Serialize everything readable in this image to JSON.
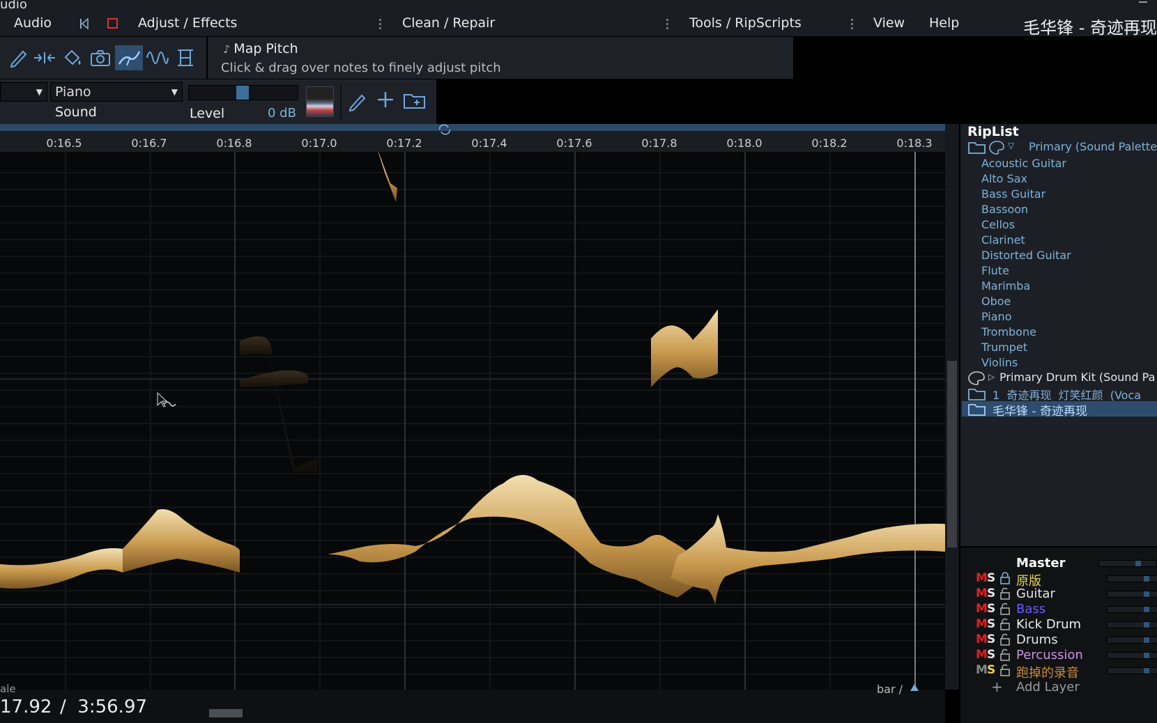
{
  "menubar": {
    "app_title_fragment": "udio",
    "items": [
      "Audio",
      "Adjust / Effects",
      "Clean / Repair",
      "Tools / RipScripts",
      "View",
      "Help"
    ],
    "song_title": "毛华锋 - 奇迹再现"
  },
  "tool_info": {
    "name": "Map Pitch",
    "hint": "Click & drag over notes to finely adjust pitch"
  },
  "sound_bar": {
    "instrument": "Piano",
    "sound_label": "Sound",
    "level_label": "Level",
    "level_value": "0 dB"
  },
  "timeline": {
    "ticks": [
      "0:16.5",
      "0:16.7",
      "0:16.8",
      "0:17.0",
      "0:17.2",
      "0:17.4",
      "0:17.6",
      "0:17.8",
      "0:18.0",
      "0:18.2",
      "0:18.3"
    ]
  },
  "footer": {
    "corner_label": "ale",
    "current_time": "17.92",
    "total_time": "/  3:56.97",
    "bar_label": "bar /"
  },
  "riplist": {
    "title": "RipList",
    "primary_label": "Primary (Sound Palette",
    "instruments": [
      "Acoustic Guitar",
      "Alto Sax",
      "Bass Guitar",
      "Bassoon",
      "Cellos",
      "Clarinet",
      "Distorted Guitar",
      "Flute",
      "Marimba",
      "Oboe",
      "Piano",
      "Trombone",
      "Trumpet",
      "Violins"
    ],
    "drum_kit_label": "Primary Drum Kit (Sound Pa",
    "vocal_label": "1  奇迹再现  灯笑红颜  (Voca",
    "selected_label": "毛华锋 - 奇迹再现"
  },
  "mixer": {
    "master_label": "Master",
    "layers": [
      {
        "name": "原版",
        "color": "#e8d44c"
      },
      {
        "name": "Guitar",
        "color": "#e6e6e6"
      },
      {
        "name": "Bass",
        "color": "#6a5cff"
      },
      {
        "name": "Kick Drum",
        "color": "#f0f0f0"
      },
      {
        "name": "Drums",
        "color": "#e6e6e6"
      },
      {
        "name": "Percussion",
        "color": "#d090e8"
      },
      {
        "name": "跑掉的录音",
        "color": "#c88b3c"
      }
    ],
    "add_layer_label": "Add Layer",
    "m_label": "M",
    "s_label": "S"
  }
}
